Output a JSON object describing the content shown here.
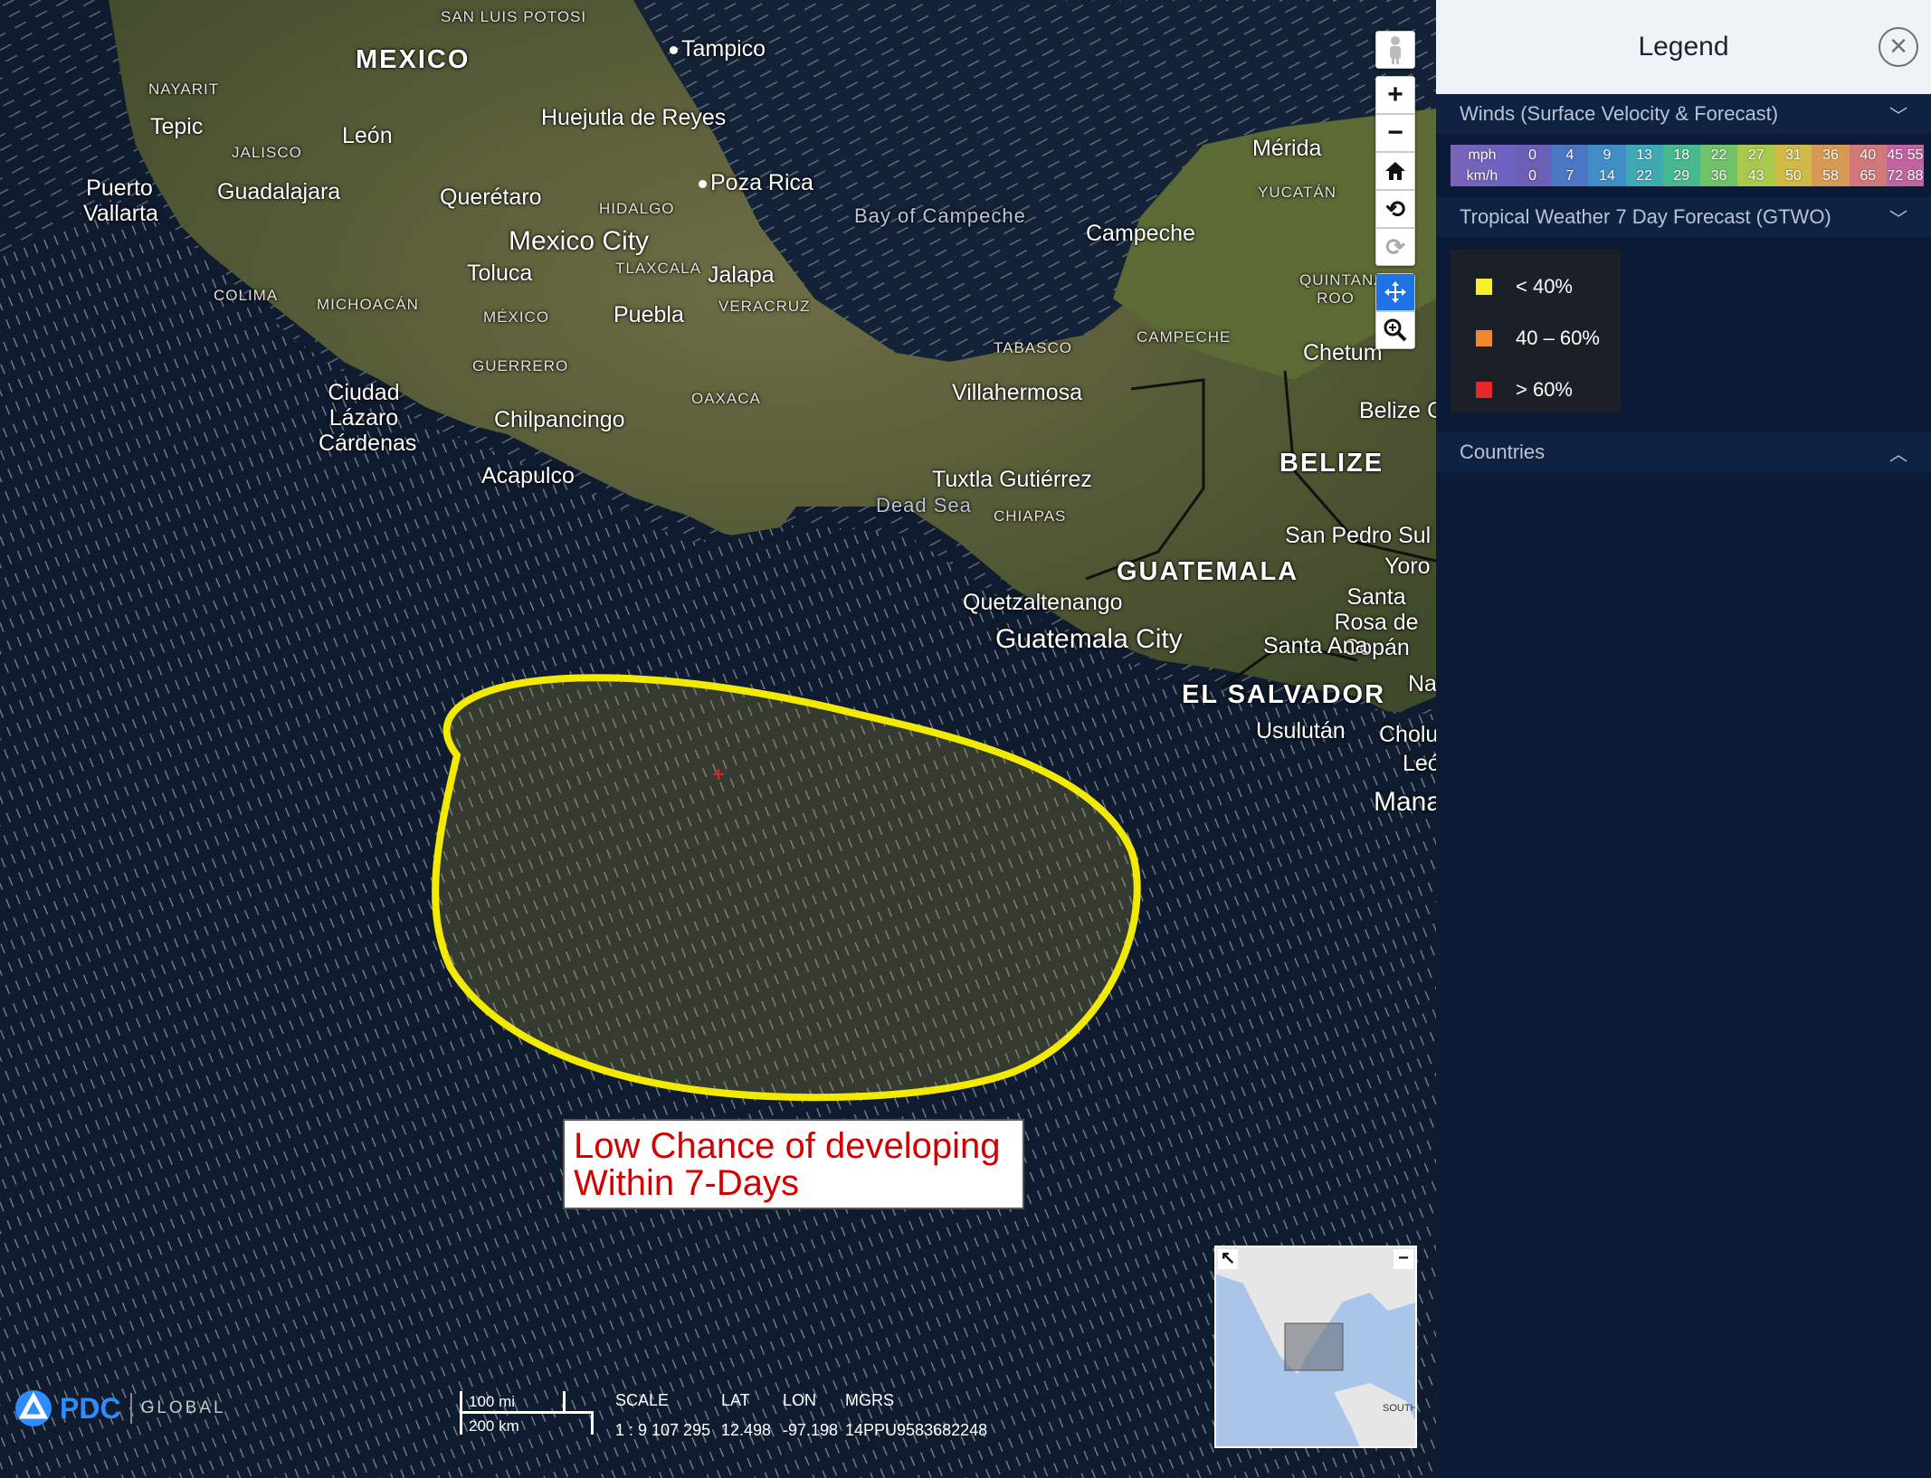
{
  "map": {
    "places": [
      {
        "id": "mexico",
        "text": "MEXICO",
        "kind": "country"
      },
      {
        "id": "guatemala",
        "text": "GUATEMALA",
        "kind": "country"
      },
      {
        "id": "belize",
        "text": "BELIZE",
        "kind": "country"
      },
      {
        "id": "el-salvador",
        "text": "EL SALVADOR",
        "kind": "country"
      },
      {
        "id": "san-luis-potosi",
        "text": "SAN LUIS POTOSI",
        "kind": "state"
      },
      {
        "id": "tampico",
        "text": "Tampico",
        "kind": "city"
      },
      {
        "id": "nayarit",
        "text": "NAYARIT",
        "kind": "state"
      },
      {
        "id": "tepic",
        "text": "Tepic",
        "kind": "city"
      },
      {
        "id": "jalisco",
        "text": "JALISCO",
        "kind": "state"
      },
      {
        "id": "leon",
        "text": "León",
        "kind": "city"
      },
      {
        "id": "huejutla",
        "text": "Huejutla de Reyes",
        "kind": "city"
      },
      {
        "id": "puerto-vallarta",
        "text": "Puerto Vallarta",
        "kind": "city"
      },
      {
        "id": "guadalajara",
        "text": "Guadalajara",
        "kind": "city"
      },
      {
        "id": "queretaro",
        "text": "Querétaro",
        "kind": "city"
      },
      {
        "id": "hidalgo",
        "text": "HIDALGO",
        "kind": "state"
      },
      {
        "id": "poza-rica",
        "text": "Poza Rica",
        "kind": "city"
      },
      {
        "id": "merida",
        "text": "Mérida",
        "kind": "city"
      },
      {
        "id": "yucatan",
        "text": "YUCATÁN",
        "kind": "state"
      },
      {
        "id": "bay-campeche",
        "text": "Bay of Campeche",
        "kind": "water"
      },
      {
        "id": "campeche-city",
        "text": "Campeche",
        "kind": "city"
      },
      {
        "id": "mexico-city",
        "text": "Mexico City",
        "kind": "big"
      },
      {
        "id": "tlaxcala",
        "text": "TLAXCALA",
        "kind": "state"
      },
      {
        "id": "toluca",
        "text": "Toluca",
        "kind": "city"
      },
      {
        "id": "jalapa",
        "text": "Jalapa",
        "kind": "city"
      },
      {
        "id": "colima",
        "text": "COLIMA",
        "kind": "state"
      },
      {
        "id": "michoacan",
        "text": "MICHOACÁN",
        "kind": "state"
      },
      {
        "id": "mexico-state",
        "text": "MÉXICO",
        "kind": "state"
      },
      {
        "id": "puebla",
        "text": "Puebla",
        "kind": "city"
      },
      {
        "id": "veracruz",
        "text": "VERACRUZ",
        "kind": "state"
      },
      {
        "id": "quintana-roo",
        "text": "QUINTANA ROO",
        "kind": "state"
      },
      {
        "id": "campeche-state",
        "text": "CAMPECHE",
        "kind": "state"
      },
      {
        "id": "tabasco",
        "text": "TABASCO",
        "kind": "state"
      },
      {
        "id": "chetumal",
        "text": "Chetum",
        "kind": "city"
      },
      {
        "id": "guerrero",
        "text": "GUERRERO",
        "kind": "state"
      },
      {
        "id": "lazaro",
        "text": "Ciudad Lázaro Cárdenas",
        "kind": "city"
      },
      {
        "id": "oaxaca",
        "text": "OAXACA",
        "kind": "state"
      },
      {
        "id": "villahermosa",
        "text": "Villahermosa",
        "kind": "city"
      },
      {
        "id": "chilpancingo",
        "text": "Chilpancingo",
        "kind": "city"
      },
      {
        "id": "belize-city",
        "text": "Belize C",
        "kind": "city"
      },
      {
        "id": "acapulco",
        "text": "Acapulco",
        "kind": "city"
      },
      {
        "id": "tuxtla",
        "text": "Tuxtla Gutiérrez",
        "kind": "city"
      },
      {
        "id": "dead-sea",
        "text": "Dead Sea",
        "kind": "water"
      },
      {
        "id": "chiapas",
        "text": "CHIAPAS",
        "kind": "state"
      },
      {
        "id": "san-pedro-sula",
        "text": "San Pedro Sul",
        "kind": "city"
      },
      {
        "id": "yoro",
        "text": "Yoro",
        "kind": "city"
      },
      {
        "id": "quetzaltenango",
        "text": "Quetzaltenango",
        "kind": "city"
      },
      {
        "id": "santa-rosa",
        "text": "Santa Rosa de Copán",
        "kind": "city"
      },
      {
        "id": "guatemala-city",
        "text": "Guatemala City",
        "kind": "big"
      },
      {
        "id": "santa-ana",
        "text": "Santa Ana",
        "kind": "city"
      },
      {
        "id": "na",
        "text": "Na",
        "kind": "city"
      },
      {
        "id": "usulutan",
        "text": "Usulután",
        "kind": "city"
      },
      {
        "id": "cholu",
        "text": "Cholu",
        "kind": "city"
      },
      {
        "id": "leo",
        "text": "León",
        "kind": "city"
      },
      {
        "id": "mana",
        "text": "Mana",
        "kind": "big"
      }
    ],
    "annotation": {
      "line1": "Low Chance of developing",
      "line2": "Within 7-Days",
      "color": "#d40000"
    },
    "outlook_area_color": "#f2ea00",
    "scale": {
      "mi_label": "100 mi",
      "km_label": "200 km",
      "scale_header": "SCALE",
      "scale_value": "1 : 9 107 295",
      "lat_header": "LAT",
      "lat_value": "12.498",
      "lon_header": "LON",
      "lon_value": "-97.198",
      "mgrs_header": "MGRS",
      "mgrs_value": "14PPU9583682248"
    },
    "logo": {
      "brand": "PDC",
      "sub": "GLOBAL"
    },
    "minimap": {
      "label": "SOUTH"
    },
    "toolbar": {
      "icons": [
        "street-view-icon",
        "zoom-in-icon",
        "zoom-out-icon",
        "home-icon",
        "rotate-left-icon",
        "rotate-right-icon",
        "pan-icon",
        "zoom-search-icon"
      ]
    }
  },
  "legend": {
    "title": "Legend",
    "sections": {
      "winds": {
        "title": "Winds (Surface Velocity & Forecast)",
        "mph_label": "mph",
        "kmh_label": "km/h",
        "mph": [
          "0",
          "4",
          "9",
          "13",
          "18",
          "22",
          "27",
          "31",
          "36",
          "40",
          "45",
          "55"
        ],
        "kmh": [
          "0",
          "7",
          "14",
          "22",
          "29",
          "36",
          "43",
          "50",
          "58",
          "65",
          "72",
          "88"
        ],
        "colors": [
          "#6b5fb7",
          "#4b76c4",
          "#3f8ec8",
          "#3ea9b4",
          "#48b98e",
          "#6fc268",
          "#a9c84e",
          "#cfba46",
          "#d79a55",
          "#d1787a",
          "#c264a0",
          "#9c5ab8"
        ]
      },
      "gtwo": {
        "title": "Tropical Weather 7 Day Forecast (GTWO)",
        "items": [
          {
            "label": "< 40%",
            "color": "#f7ef2a"
          },
          {
            "label": "40 – 60%",
            "color": "#ef8a2c"
          },
          {
            "label": "> 60%",
            "color": "#e8262a"
          }
        ]
      },
      "countries": {
        "title": "Countries"
      }
    }
  }
}
